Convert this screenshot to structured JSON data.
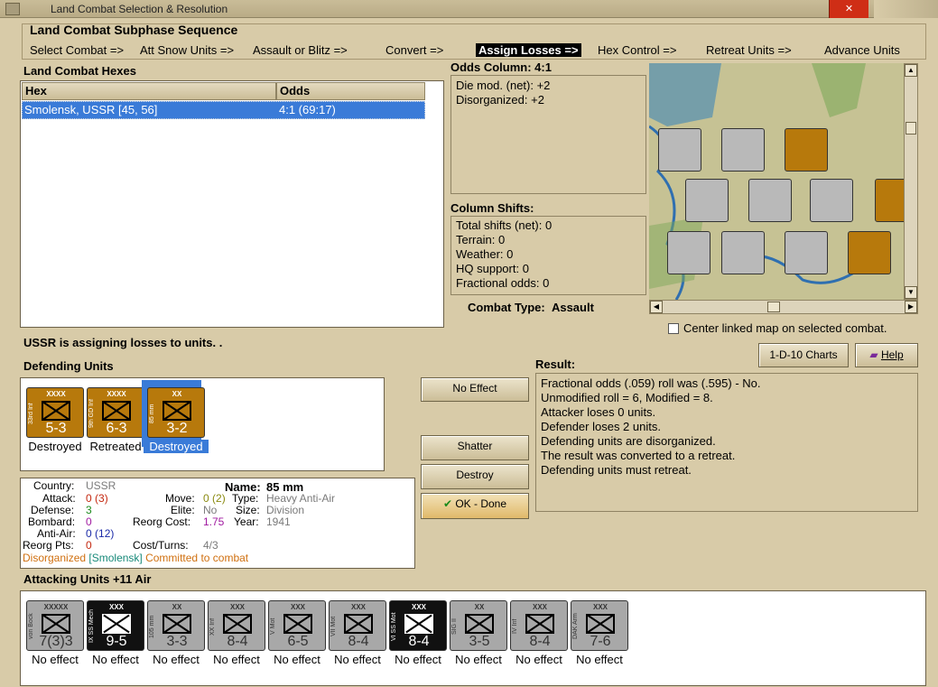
{
  "window": {
    "title": "Land Combat Selection & Resolution"
  },
  "sequence": {
    "heading": "Land Combat Subphase Sequence",
    "steps": [
      "Select Combat =>",
      "Att Snow Units =>",
      "Assault or Blitz =>",
      "Convert =>",
      "Assign Losses =>",
      "Hex Control =>",
      "Retreat Units =>",
      "Advance Units"
    ],
    "active_index": 4
  },
  "hexes": {
    "heading": "Land Combat Hexes",
    "columns": [
      "Hex",
      "Odds"
    ],
    "rows": [
      {
        "hex": "Smolensk, USSR [45, 56]",
        "odds": "4:1 (69:17)"
      }
    ]
  },
  "odds": {
    "heading": "Odds Column: 4:1",
    "lines": [
      "Die mod. (net): +2",
      "Disorganized: +2"
    ]
  },
  "shifts": {
    "heading": "Column Shifts:",
    "lines": [
      "Total shifts (net): 0",
      "Terrain: 0",
      "Weather: 0",
      "HQ support: 0",
      "Fractional odds: 0"
    ]
  },
  "combat_type": {
    "label": "Combat Type:",
    "value": "Assault"
  },
  "map": {
    "center_linked_label": "Center linked map on selected combat."
  },
  "status": "USSR is assigning losses to units. .",
  "buttons": {
    "charts": "1-D-10 Charts",
    "help": "Help",
    "no_effect": "No Effect",
    "shatter": "Shatter",
    "destroy": "Destroy",
    "ok_done": "OK - Done"
  },
  "defending": {
    "heading": "Defending Units",
    "units": [
      {
        "name": "33rd Inf",
        "size": "XXXX",
        "strength": "5-3",
        "caption": "Destroyed",
        "selected": false,
        "color": "#b7790c"
      },
      {
        "name": "9th GD Inf",
        "size": "XXXX",
        "strength": "6-3",
        "caption": "Retreated",
        "selected": false,
        "color": "#b7790c"
      },
      {
        "name": "85 mm",
        "size": "XX",
        "strength": "3-2",
        "caption": "Destroyed",
        "selected": true,
        "color": "#b7790c"
      }
    ]
  },
  "result": {
    "heading": "Result:",
    "lines": [
      "Fractional odds (.059) roll was (.595)  - No.",
      "Unmodified roll = 6, Modified = 8.",
      "Attacker loses 0 units.",
      "Defender loses 2 units.",
      "Defending units are disorganized.",
      "The result was converted to a retreat.",
      "Defending units must retreat."
    ]
  },
  "unit_info": {
    "country_label": "Country:",
    "country": "USSR",
    "name_label": "Name:",
    "name": "85 mm",
    "attack_label": "Attack:",
    "attack": "0",
    "attack_paren": "(3)",
    "move_label": "Move:",
    "move": "0",
    "move_paren": "(2)",
    "type_label": "Type:",
    "type": "Heavy Anti-Air",
    "defense_label": "Defense:",
    "defense": "3",
    "elite_label": "Elite:",
    "elite": "No",
    "size_label": "Size:",
    "size": "Division",
    "bombard_label": "Bombard:",
    "bombard": "0",
    "reorg_cost_label": "Reorg Cost:",
    "reorg_cost": "1.75",
    "year_label": "Year:",
    "year": "1941",
    "antiair_label": "Anti-Air:",
    "antiair": "0",
    "antiair_paren": "(12)",
    "reorg_pts_label": "Reorg Pts:",
    "reorg_pts": "0",
    "cost_turns_label": "Cost/Turns:",
    "cost_turns": "4/3",
    "status_disorg": "Disorganized",
    "status_loc": "[Smolensk]",
    "status_committed": "Committed to combat"
  },
  "attacking": {
    "heading": "Attacking Units +11 Air",
    "units": [
      {
        "name": "von Bock",
        "size": "XXXXX",
        "strength": "7(3)3",
        "caption": "No effect",
        "color": "#a8a8a8"
      },
      {
        "name": "IX SS Mech",
        "size": "XXX",
        "strength": "9-5",
        "caption": "No effect",
        "color": "#111111"
      },
      {
        "name": "105 mm",
        "size": "XX",
        "strength": "3-3",
        "caption": "No effect",
        "color": "#a8a8a8"
      },
      {
        "name": "XX Inf",
        "size": "XXX",
        "strength": "8-4",
        "caption": "No effect",
        "color": "#a8a8a8"
      },
      {
        "name": "V Mot",
        "size": "XXX",
        "strength": "6-5",
        "caption": "No effect",
        "color": "#a8a8a8"
      },
      {
        "name": "VII Mot",
        "size": "XXX",
        "strength": "8-4",
        "caption": "No effect",
        "color": "#a8a8a8"
      },
      {
        "name": "VI SS Mot",
        "size": "XXX",
        "strength": "8-4",
        "caption": "No effect",
        "color": "#111111"
      },
      {
        "name": "SIG II",
        "size": "XX",
        "strength": "3-5",
        "caption": "No effect",
        "color": "#a8a8a8"
      },
      {
        "name": "IV Inf",
        "size": "XXX",
        "strength": "8-4",
        "caption": "No effect",
        "color": "#a8a8a8"
      },
      {
        "name": "DAK Arm",
        "size": "XXX",
        "strength": "7-6",
        "caption": "No effect",
        "color": "#a8a8a8"
      }
    ]
  },
  "icons": {
    "close": "close-icon",
    "help": "help-book-icon",
    "ok": "checkmark-icon"
  }
}
